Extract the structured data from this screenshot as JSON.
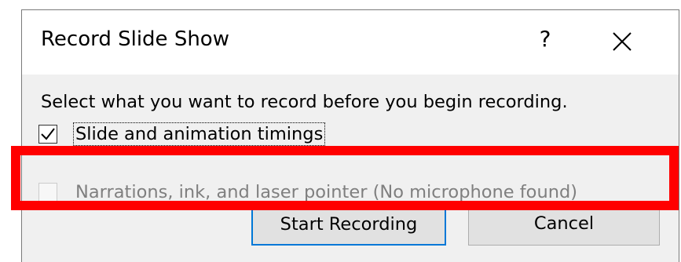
{
  "dialog": {
    "title": "Record Slide Show",
    "help_label": "?",
    "close_icon": "close-icon"
  },
  "body": {
    "prompt": "Select what you want to record before you begin recording.",
    "options": [
      {
        "label": "Slide and animation timings",
        "checked": true,
        "enabled": true
      },
      {
        "label": "Narrations, ink, and laser pointer (No microphone found)",
        "checked": false,
        "enabled": false
      }
    ]
  },
  "buttons": {
    "start_label": "Start Recording",
    "cancel_label": "Cancel"
  },
  "annotation": {
    "highlight_color": "#ff0000",
    "accent_color": "#0078d7"
  }
}
